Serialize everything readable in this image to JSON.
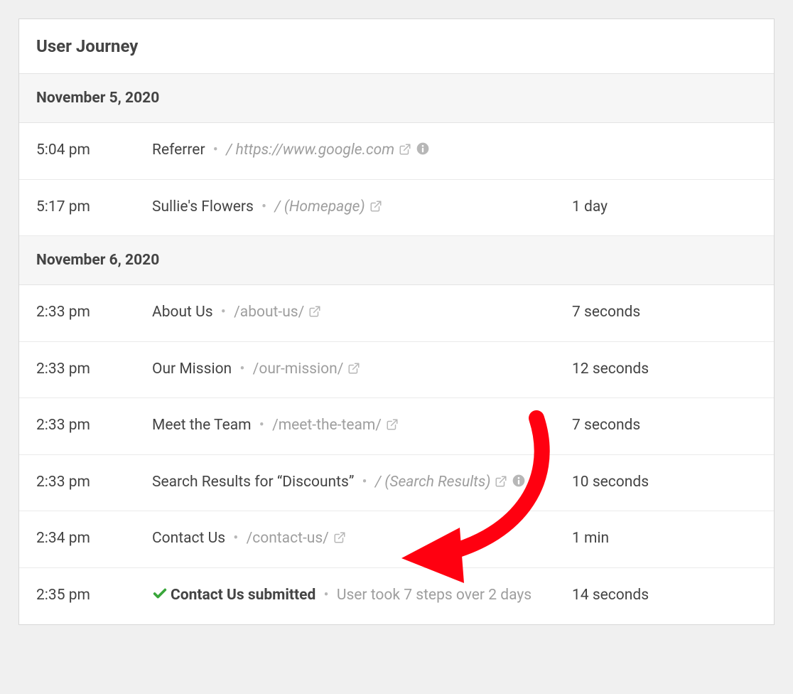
{
  "panel": {
    "title": "User Journey"
  },
  "groups": [
    {
      "date": "November 5, 2020",
      "rows": [
        {
          "time": "5:04 pm",
          "title": "Referrer",
          "title_bold": false,
          "path": "/ https://www.google.com",
          "path_italic": true,
          "has_external": true,
          "has_info": true,
          "has_check": false,
          "summary": "",
          "duration": ""
        },
        {
          "time": "5:17 pm",
          "title": "Sullie's Flowers",
          "title_bold": false,
          "path": "/ (Homepage)",
          "path_italic": true,
          "has_external": true,
          "has_info": false,
          "has_check": false,
          "summary": "",
          "duration": "1 day"
        }
      ]
    },
    {
      "date": "November 6, 2020",
      "rows": [
        {
          "time": "2:33 pm",
          "title": "About Us",
          "title_bold": false,
          "path": "/about-us/",
          "path_italic": false,
          "has_external": true,
          "has_info": false,
          "has_check": false,
          "summary": "",
          "duration": "7 seconds"
        },
        {
          "time": "2:33 pm",
          "title": "Our Mission",
          "title_bold": false,
          "path": "/our-mission/",
          "path_italic": false,
          "has_external": true,
          "has_info": false,
          "has_check": false,
          "summary": "",
          "duration": "12 seconds"
        },
        {
          "time": "2:33 pm",
          "title": "Meet the Team",
          "title_bold": false,
          "path": "/meet-the-team/",
          "path_italic": false,
          "has_external": true,
          "has_info": false,
          "has_check": false,
          "summary": "",
          "duration": "7 seconds"
        },
        {
          "time": "2:33 pm",
          "title": "Search Results for “Discounts”",
          "title_bold": false,
          "path": "/ (Search Results)",
          "path_italic": true,
          "has_external": true,
          "has_info": true,
          "has_check": false,
          "summary": "",
          "duration": "10 seconds"
        },
        {
          "time": "2:34 pm",
          "title": "Contact Us",
          "title_bold": false,
          "path": "/contact-us/",
          "path_italic": false,
          "has_external": true,
          "has_info": false,
          "has_check": false,
          "summary": "",
          "duration": "1 min"
        },
        {
          "time": "2:35 pm",
          "title": "Contact Us submitted",
          "title_bold": true,
          "path": "",
          "path_italic": false,
          "has_external": false,
          "has_info": false,
          "has_check": true,
          "summary": "User took 7 steps over 2 days",
          "duration": "14 seconds"
        }
      ]
    }
  ],
  "annotation": {
    "color": "#ff0000",
    "description": "curved red arrow pointing to Contact Us row"
  }
}
